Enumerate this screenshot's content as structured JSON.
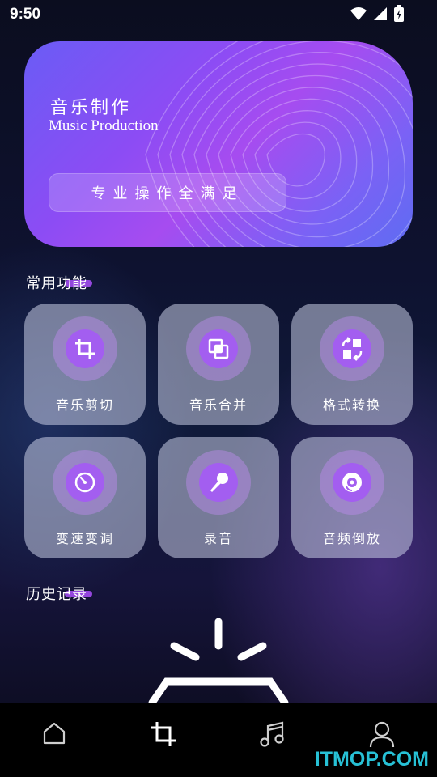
{
  "status": {
    "time": "9:50"
  },
  "banner": {
    "title": "音乐制作",
    "subtitle": "Music Production",
    "button": "专业操作全满足"
  },
  "sections": {
    "common": "常用功能",
    "history": "历史记录"
  },
  "tools": [
    {
      "label": "音乐剪切",
      "icon": "crop-icon"
    },
    {
      "label": "音乐合并",
      "icon": "merge-icon"
    },
    {
      "label": "格式转换",
      "icon": "convert-icon"
    },
    {
      "label": "变速变调",
      "icon": "speed-dial-icon"
    },
    {
      "label": "录音",
      "icon": "microphone-icon"
    },
    {
      "label": "音频倒放",
      "icon": "reverse-disc-icon"
    }
  ],
  "nav": [
    {
      "icon": "home-icon"
    },
    {
      "icon": "crop-icon"
    },
    {
      "icon": "music-note-icon"
    },
    {
      "icon": "profile-icon"
    }
  ],
  "watermark": "ITMOP.COM",
  "colors": {
    "accent": "#a35ef0",
    "watermark": "#27c1d6"
  }
}
